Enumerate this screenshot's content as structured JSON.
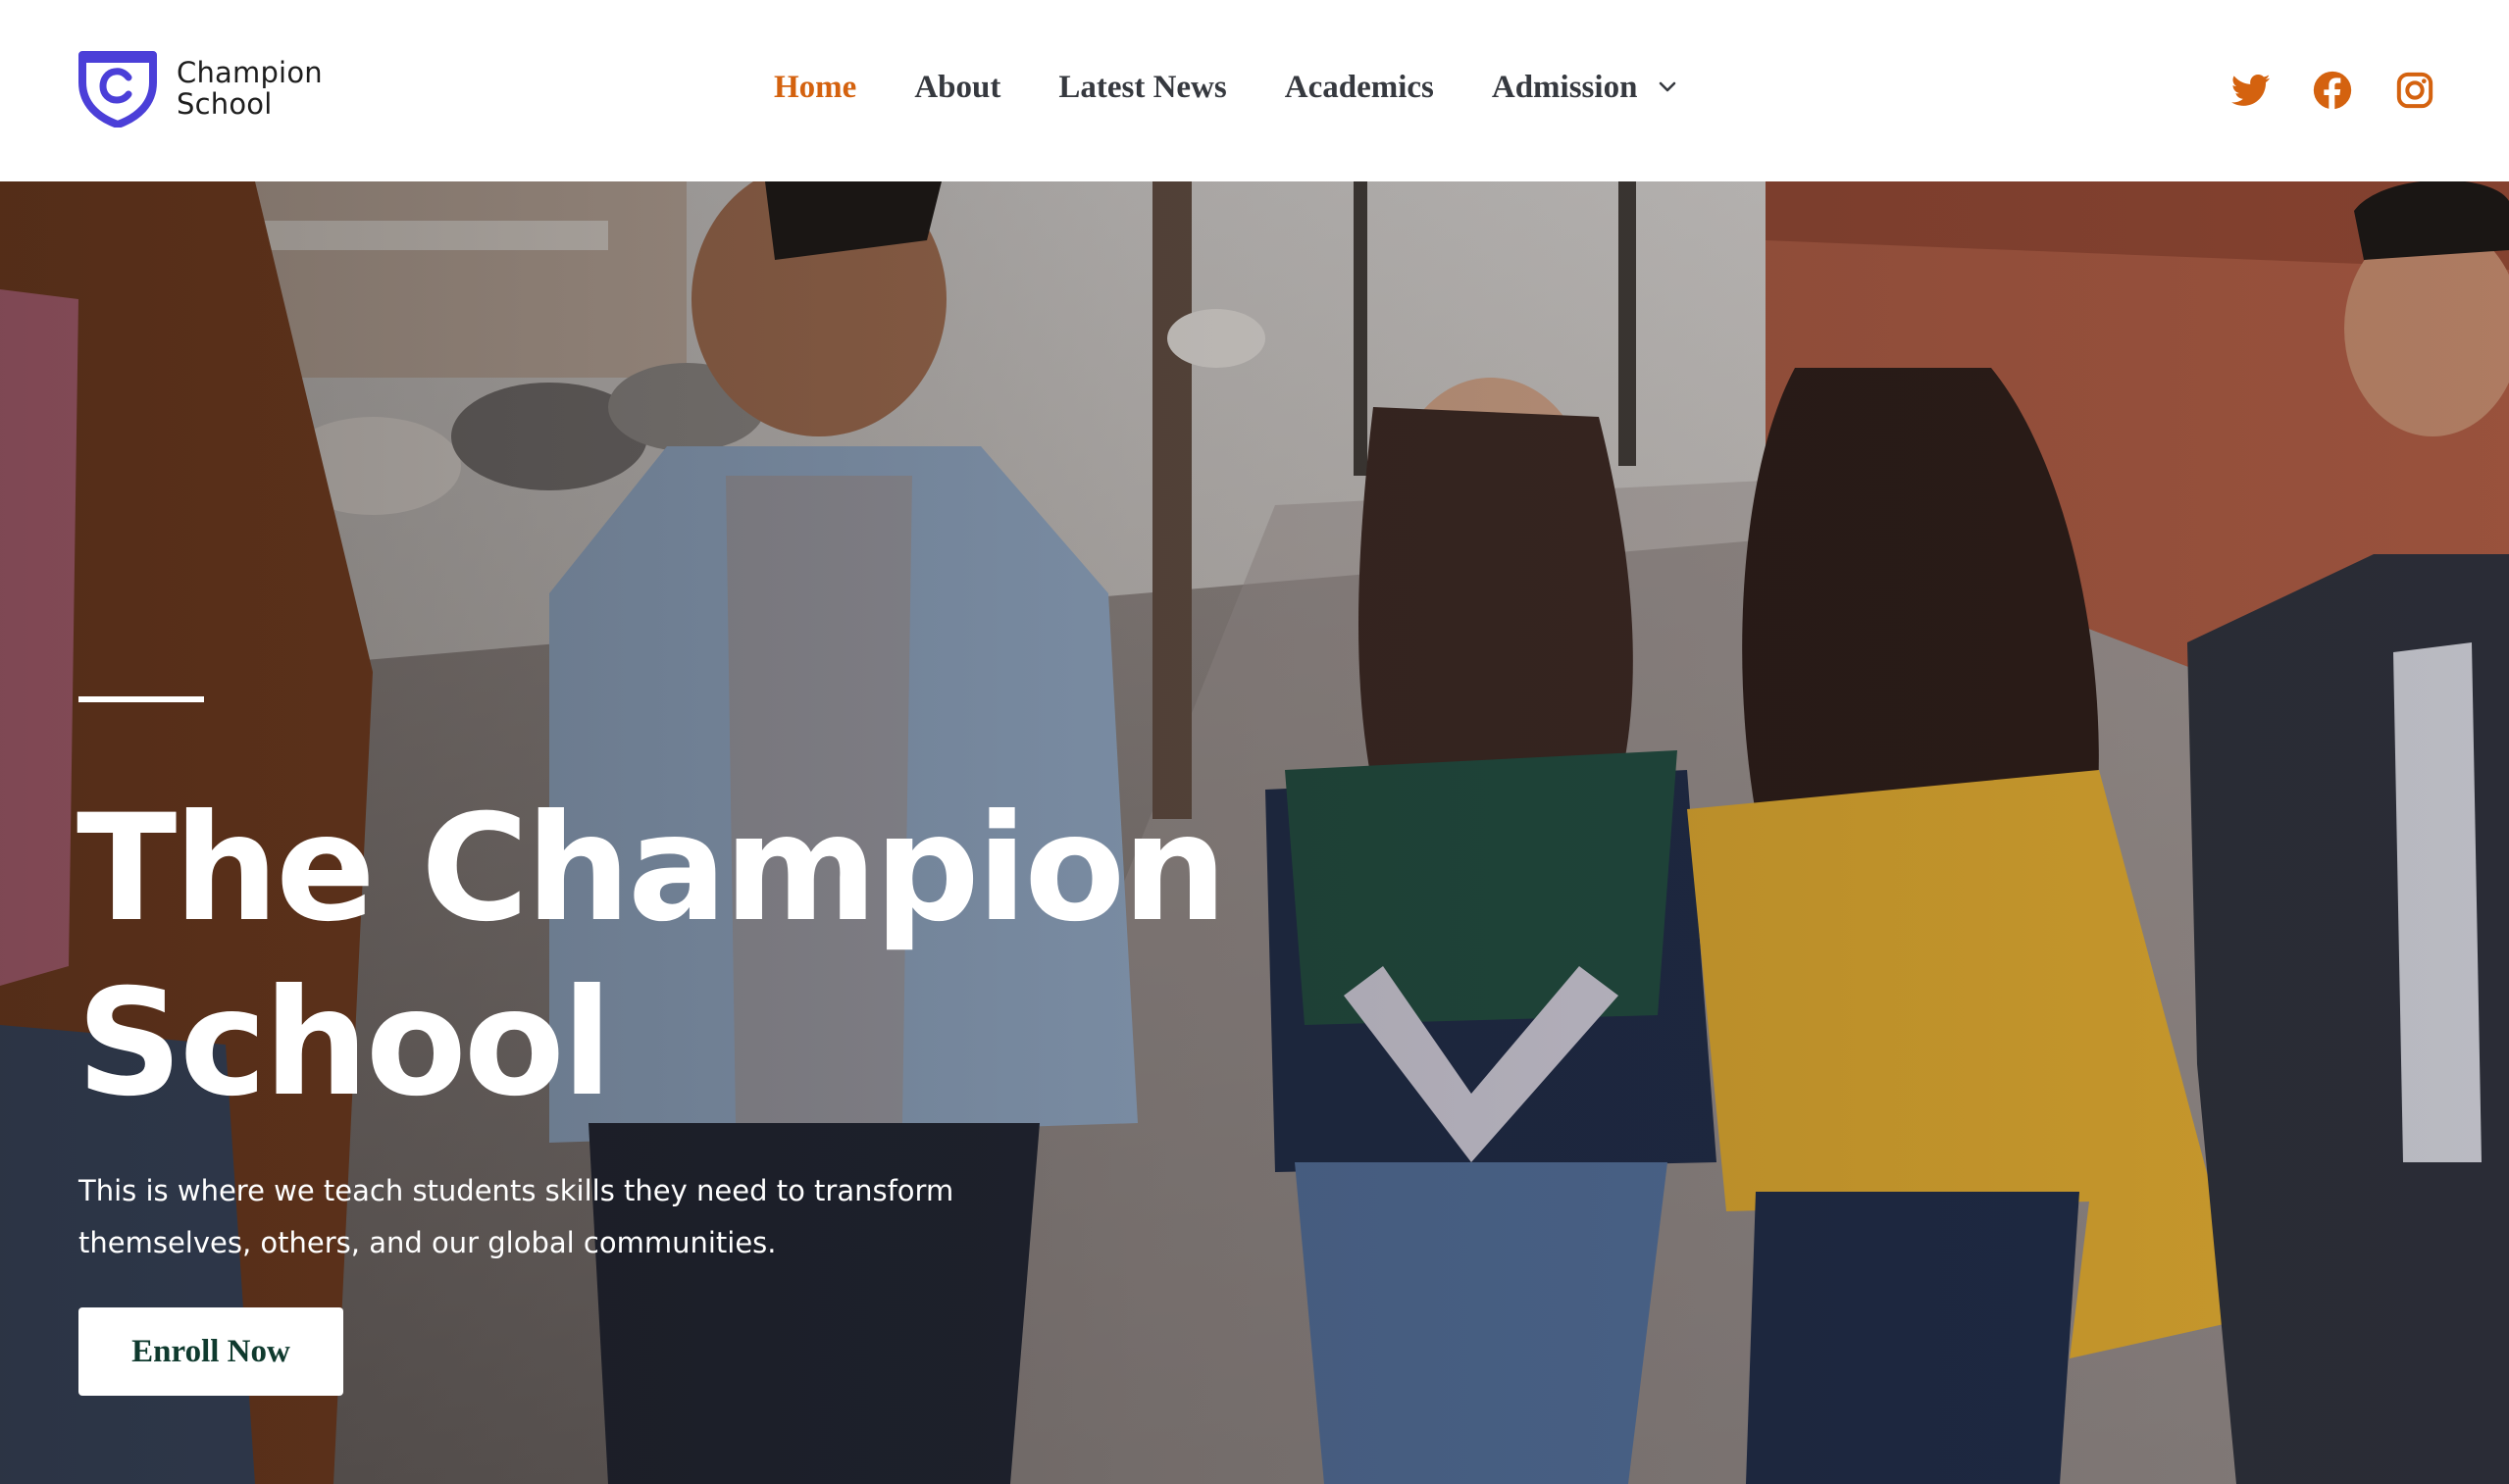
{
  "brand": {
    "name_line1": "Champion",
    "name_line2": "School",
    "logo_letter": "C",
    "logo_color": "#4b3fd8"
  },
  "nav": {
    "items": [
      {
        "label": "Home",
        "active": true
      },
      {
        "label": "About",
        "active": false
      },
      {
        "label": "Latest News",
        "active": false
      },
      {
        "label": "Academics",
        "active": false
      },
      {
        "label": "Admission",
        "active": false,
        "has_dropdown": true
      }
    ],
    "active_color": "#d4620f",
    "text_color": "#36393f"
  },
  "social": {
    "color": "#d4620f",
    "icons": [
      "twitter-icon",
      "facebook-icon",
      "instagram-icon"
    ]
  },
  "hero": {
    "title_line1": "The Champion",
    "title_line2": "School",
    "subtitle_line1": "This is where we teach students skills they need to transform",
    "subtitle_line2": "themselves, others, and our global communities.",
    "cta_label": "Enroll Now",
    "cta_text_color": "#0f3a2e"
  }
}
